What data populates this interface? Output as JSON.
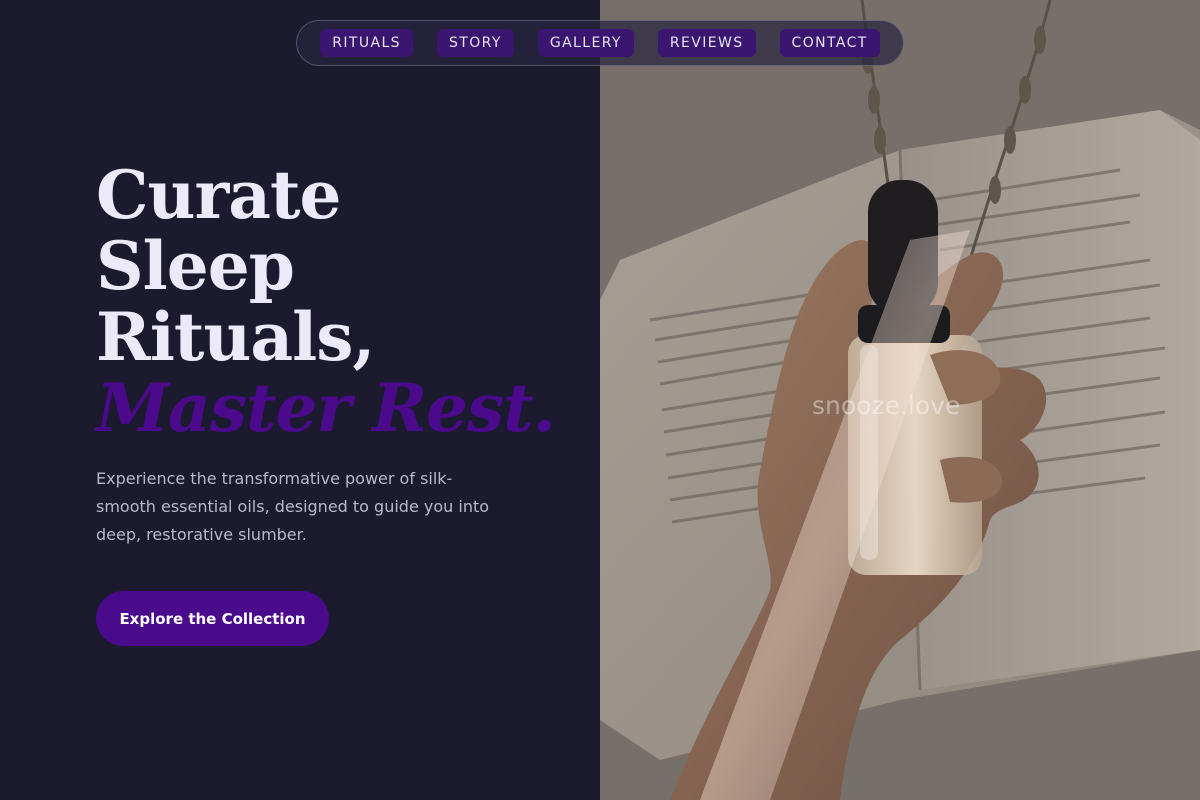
{
  "nav": {
    "links": [
      "RITUALS",
      "STORY",
      "GALLERY",
      "REVIEWS",
      "CONTACT"
    ]
  },
  "hero": {
    "headline_lines": [
      "Curate",
      "Sleep",
      "Rituals,"
    ],
    "headline_accent": "Master Rest.",
    "subtitle": "Experience the transformative power of silk-smooth essential oils, designed to guide you into deep, restorative slumber.",
    "cta_label": "Explore the Collection"
  },
  "watermark": "snooze.love",
  "colors": {
    "background": "#1b1a2e",
    "accent": "#4a0a8c",
    "headline": "#eceaf8",
    "subtitle": "#b9b8cc",
    "nav_chip": "#3a1670"
  }
}
